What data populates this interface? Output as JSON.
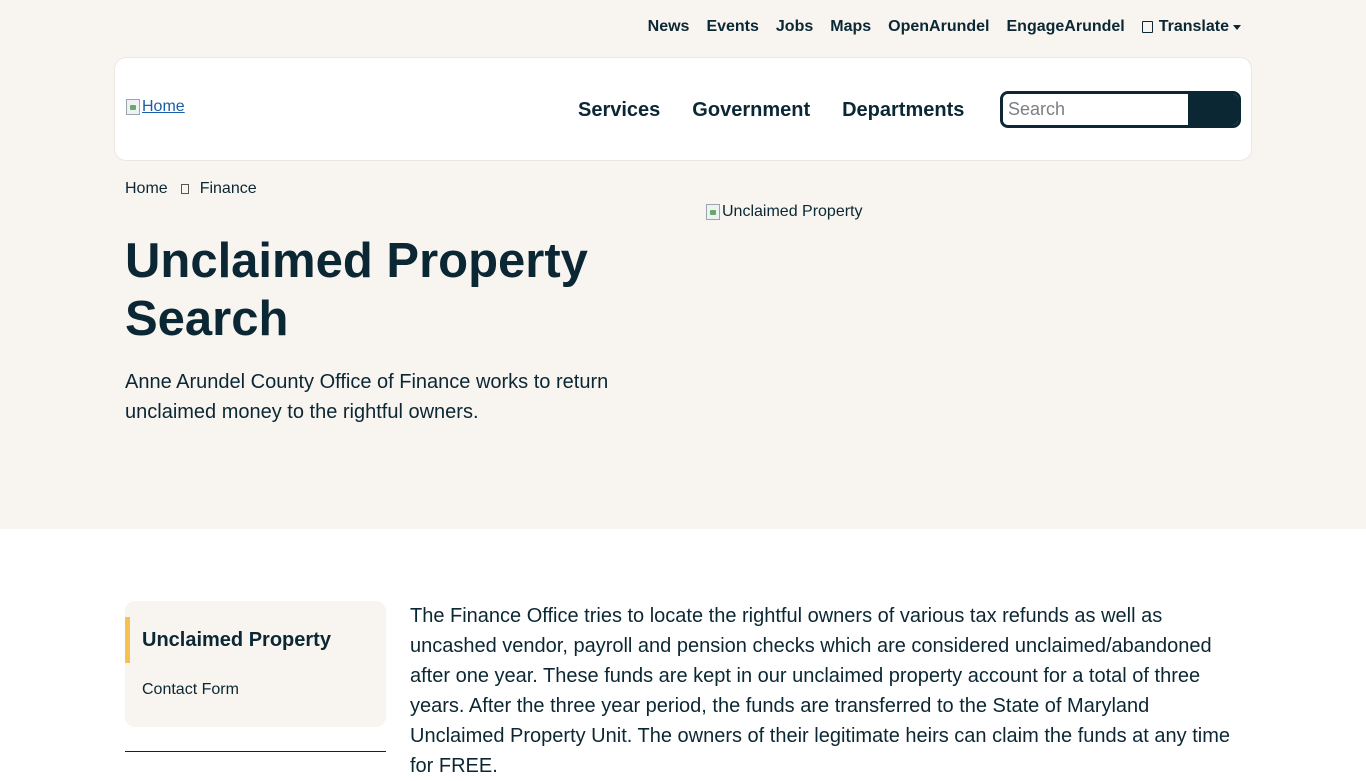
{
  "utility_nav": {
    "items": [
      "News",
      "Events",
      "Jobs",
      "Maps",
      "OpenArundel",
      "EngageArundel"
    ],
    "translate_label": "Translate"
  },
  "header": {
    "logo_alt": "Home",
    "nav": [
      "Services",
      "Government",
      "Departments"
    ],
    "search_placeholder": "Search"
  },
  "breadcrumb": [
    "Home",
    "Finance"
  ],
  "hero": {
    "title": "Unclaimed Property Search",
    "intro": "Anne Arundel County Office of Finance works to return unclaimed money to the rightful owners.",
    "image_alt": "Unclaimed Property"
  },
  "sidebar": {
    "active": "Unclaimed Property",
    "links": [
      "Contact Form"
    ]
  },
  "main": {
    "body": "The Finance Office tries to locate the rightful owners of various tax refunds as well as uncashed vendor, payroll and pension checks which are considered unclaimed/abandoned after one year. These funds are kept in our unclaimed property account for a total of three years. After the three year period, the funds are transferred to the State of Maryland Unclaimed Property Unit. The owners of their legitimate heirs can claim the funds at any time for FREE."
  },
  "colors": {
    "navy": "#0b2733",
    "hero_bg": "#f8f4f0",
    "accent": "#f5c14f",
    "link": "#1a5ea8"
  }
}
